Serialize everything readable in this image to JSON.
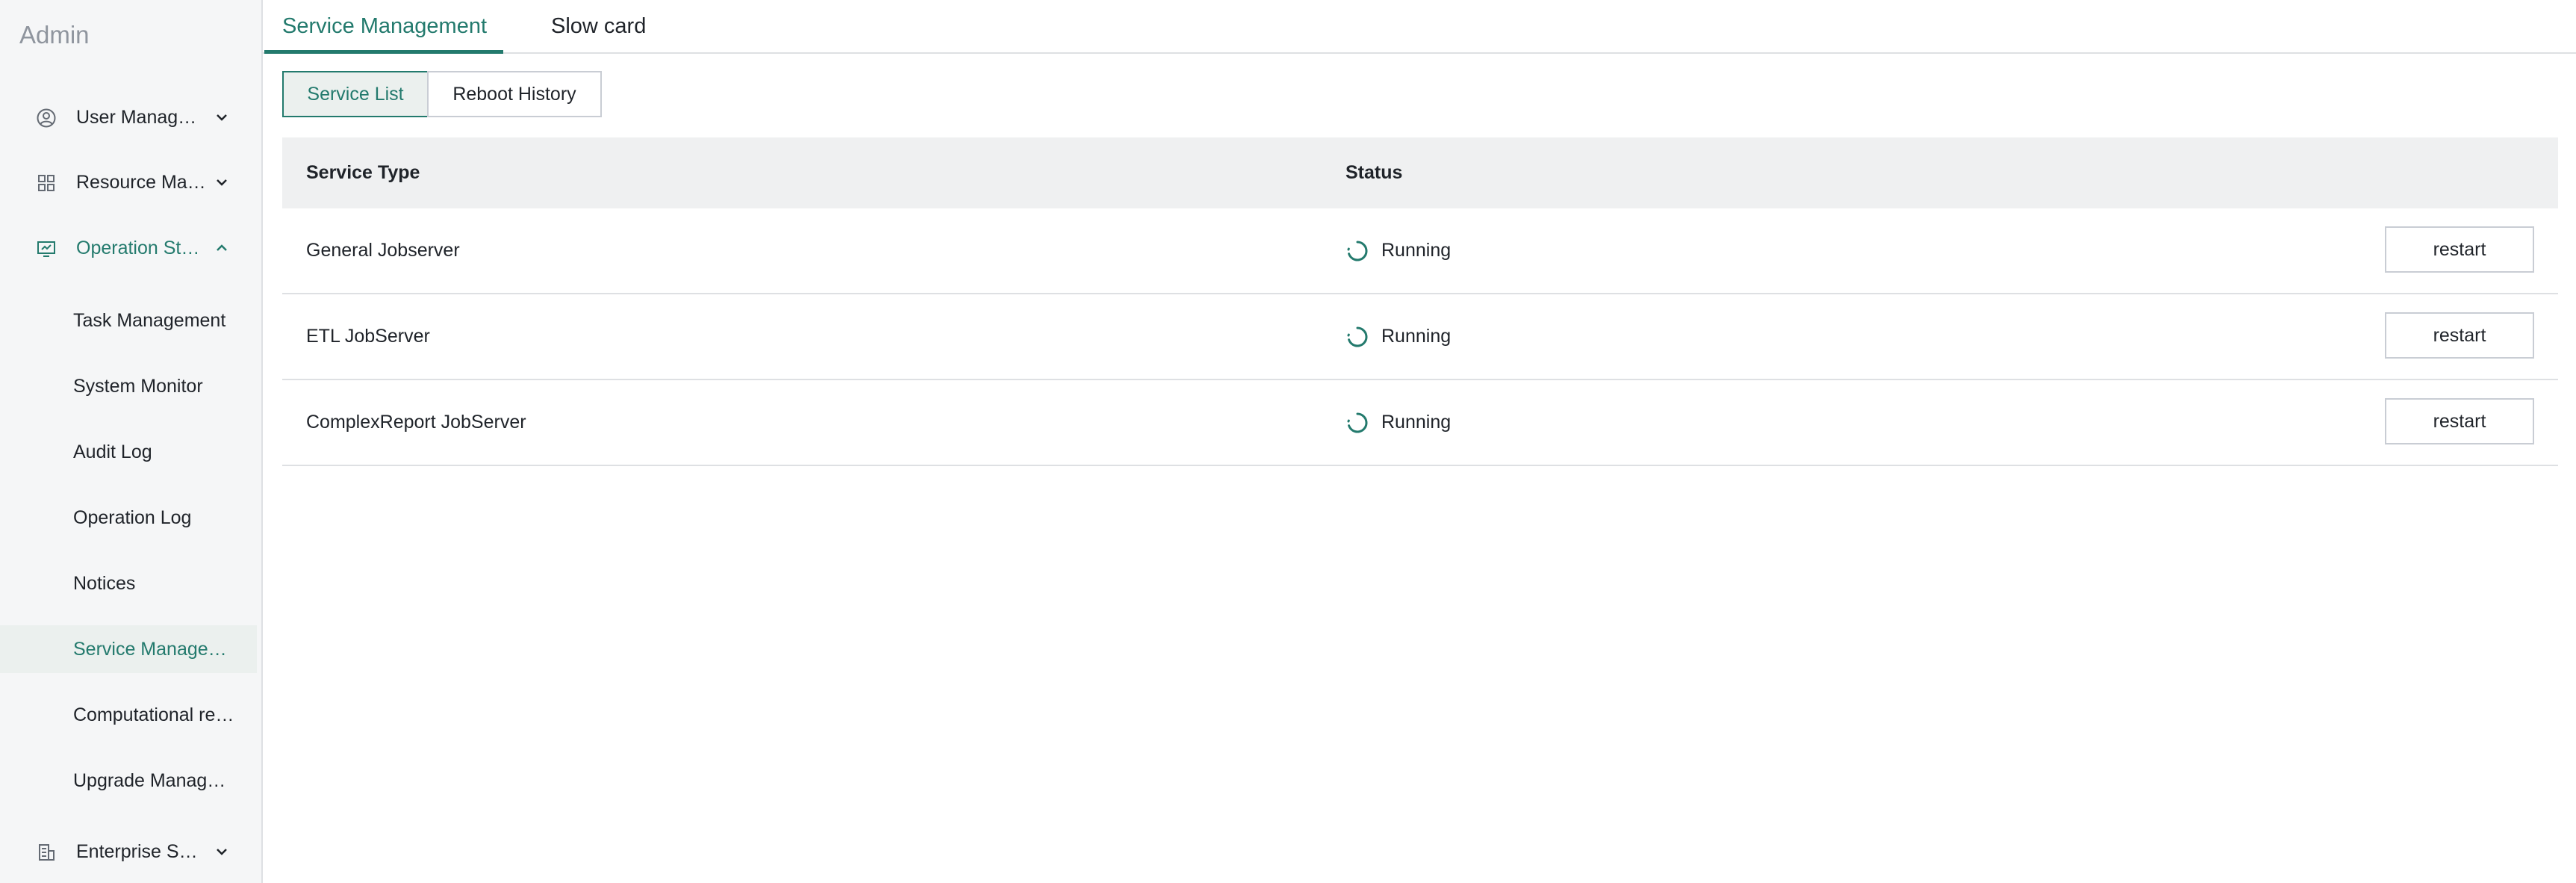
{
  "sidebar": {
    "brand": "Admin",
    "groups": [
      {
        "label": "User Management",
        "icon": "user-circle-icon",
        "expanded": false
      },
      {
        "label": "Resource Management",
        "icon": "grid-icon",
        "expanded": false
      },
      {
        "label": "Operation Status",
        "icon": "monitor-icon",
        "expanded": true
      },
      {
        "label": "Enterprise Settings",
        "icon": "building-icon",
        "expanded": false
      }
    ],
    "sub_items": [
      {
        "label": "Task Management"
      },
      {
        "label": "System Monitor"
      },
      {
        "label": "Audit Log"
      },
      {
        "label": "Operation Log"
      },
      {
        "label": "Notices"
      },
      {
        "label": "Service Management",
        "active": true
      },
      {
        "label": "Computational resources"
      },
      {
        "label": "Upgrade Management"
      }
    ]
  },
  "tabs": [
    {
      "label": "Service Management",
      "active": true
    },
    {
      "label": "Slow card",
      "active": false
    }
  ],
  "segments": [
    {
      "label": "Service List",
      "active": true
    },
    {
      "label": "Reboot History",
      "active": false
    }
  ],
  "table": {
    "headers": {
      "service_type": "Service Type",
      "status": "Status"
    },
    "rows": [
      {
        "service_type": "General Jobserver",
        "status": "Running",
        "action": "restart"
      },
      {
        "service_type": "ETL JobServer",
        "status": "Running",
        "action": "restart"
      },
      {
        "service_type": "ComplexReport JobServer",
        "status": "Running",
        "action": "restart"
      }
    ]
  },
  "colors": {
    "accent": "#237a6d",
    "sidebar_bg": "#f5f6f7",
    "header_bg": "#eff0f1"
  }
}
